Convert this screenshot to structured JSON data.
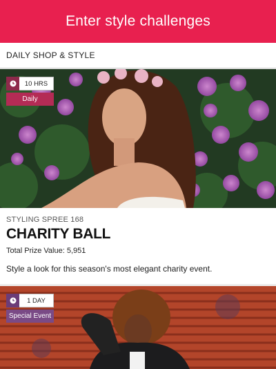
{
  "header": {
    "title": "Enter style challenges"
  },
  "section": {
    "title": "DAILY SHOP & STYLE"
  },
  "challenges": [
    {
      "timer": "10 HRS",
      "timer_icon": "clock-icon",
      "tag": "Daily",
      "tag_color": "#b42b55",
      "subtitle": "STYLING SPREE 168",
      "title": "CHARITY BALL",
      "prize_label": "Total Prize Value: 5,951",
      "description": "Style a look for this season's most elegant charity event."
    },
    {
      "timer": "1 DAY",
      "timer_icon": "clock-icon",
      "tag": "Special Event",
      "tag_color": "#7a4a86"
    }
  ],
  "colors": {
    "accent": "#e8204f"
  }
}
